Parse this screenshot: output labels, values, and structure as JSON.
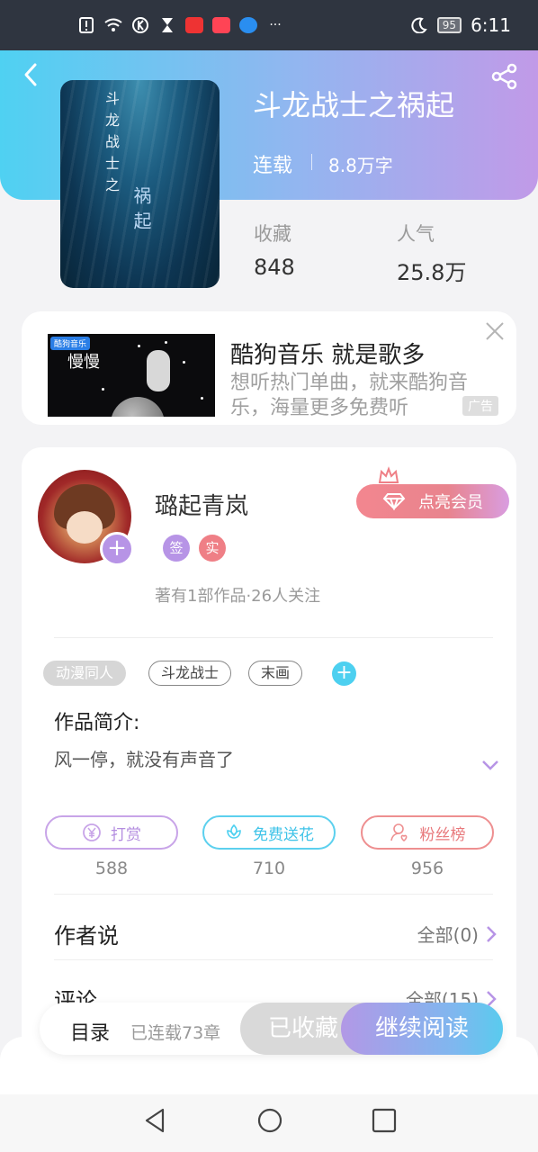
{
  "status_bar": {
    "time": "6:11",
    "battery": "95"
  },
  "book": {
    "title": "斗龙战士之祸起",
    "serial_status": "连载",
    "word_count": "8.8万字",
    "cover_text_top": "斗龙战士之",
    "cover_text_bottom": "祸起",
    "stats": [
      {
        "label": "收藏",
        "value": "848"
      },
      {
        "label": "人气",
        "value": "25.8万"
      }
    ]
  },
  "ad": {
    "title": "酷狗音乐 就是歌多",
    "description": "想听热门单曲，就来酷狗音乐，海量更多免费听",
    "badge": "广告",
    "image_logo": "酷狗音乐",
    "image_text": "慢慢"
  },
  "author": {
    "name": "璐起青岚",
    "badges": [
      "签",
      "实"
    ],
    "info": "著有1部作品·26人关注",
    "vip_button": "点亮会员"
  },
  "tags": [
    "动漫同人",
    "斗龙战士",
    "末画"
  ],
  "intro": {
    "heading": "作品简介:",
    "text": "风一停，就没有声音了"
  },
  "actions": [
    {
      "label": "打赏",
      "count": "588",
      "icon": "yen-icon"
    },
    {
      "label": "免费送花",
      "count": "710",
      "icon": "flower-icon"
    },
    {
      "label": "粉丝榜",
      "count": "956",
      "icon": "fan-icon"
    }
  ],
  "rows": [
    {
      "title": "作者说",
      "right": "全部(0)"
    },
    {
      "title": "评论",
      "right": "全部(15)"
    }
  ],
  "bottom_bar": {
    "directory": "目录",
    "chapters": "已连载73章",
    "collected": "已收藏",
    "continue_read": "继续阅读"
  },
  "colors": {
    "accent_cyan": "#4dd0f0",
    "accent_purple": "#b794e6",
    "vip_pink": "#f3868f"
  }
}
